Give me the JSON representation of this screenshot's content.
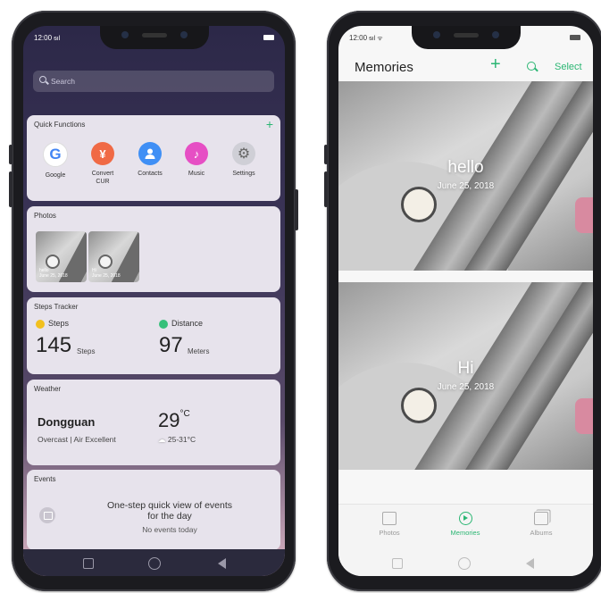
{
  "left_phone": {
    "status": {
      "time": "12:00"
    },
    "search": {
      "placeholder": "Search"
    },
    "quick_functions": {
      "title": "Quick Functions",
      "add_symbol": "+",
      "items": [
        {
          "label": "Google",
          "icon": "google-icon",
          "color": "#ffffff",
          "glyph": "G"
        },
        {
          "label": "Convert CUR",
          "icon": "currency-icon",
          "color": "#f06a45",
          "glyph": "¥"
        },
        {
          "label": "Contacts",
          "icon": "contacts-icon",
          "color": "#3f8ff5",
          "glyph": "👤"
        },
        {
          "label": "Music",
          "icon": "music-icon",
          "color": "#e64fc4",
          "glyph": "♪"
        },
        {
          "label": "Settings",
          "icon": "settings-icon",
          "color": "#c9c9cf",
          "glyph": "⚙"
        }
      ]
    },
    "photos": {
      "title": "Photos",
      "thumbs": [
        {
          "caption": "hello",
          "date": "June 25, 2018"
        },
        {
          "caption": "Hi",
          "date": "June 25, 2018"
        }
      ]
    },
    "steps": {
      "title": "Steps Tracker",
      "steps_label": "Steps",
      "steps_value": "145",
      "steps_unit": "Steps",
      "distance_label": "Distance",
      "distance_value": "97",
      "distance_unit": "Meters"
    },
    "weather": {
      "title": "Weather",
      "city": "Dongguan",
      "condition": "Overcast",
      "separator": "|",
      "air": "Air Excellent",
      "temp": "29",
      "temp_unit": "°C",
      "range": "25-31°C"
    },
    "events": {
      "title": "Events",
      "line1": "One-step quick view of events",
      "line2": "for the day",
      "none": "No events today"
    }
  },
  "right_phone": {
    "status": {
      "time": "12:00"
    },
    "title": "Memories",
    "add_symbol": "+",
    "select_label": "Select",
    "memories": [
      {
        "title": "hello",
        "date": "June 25, 2018"
      },
      {
        "title": "Hi",
        "date": "June 25, 2018"
      }
    ],
    "tabs": [
      {
        "label": "Photos",
        "icon": "photos-icon",
        "active": false
      },
      {
        "label": "Memories",
        "icon": "memories-play-icon",
        "active": true
      },
      {
        "label": "Albums",
        "icon": "albums-icon",
        "active": false
      }
    ]
  },
  "colors": {
    "accent": "#2bb673",
    "card_bg": "#e7e3ec"
  }
}
